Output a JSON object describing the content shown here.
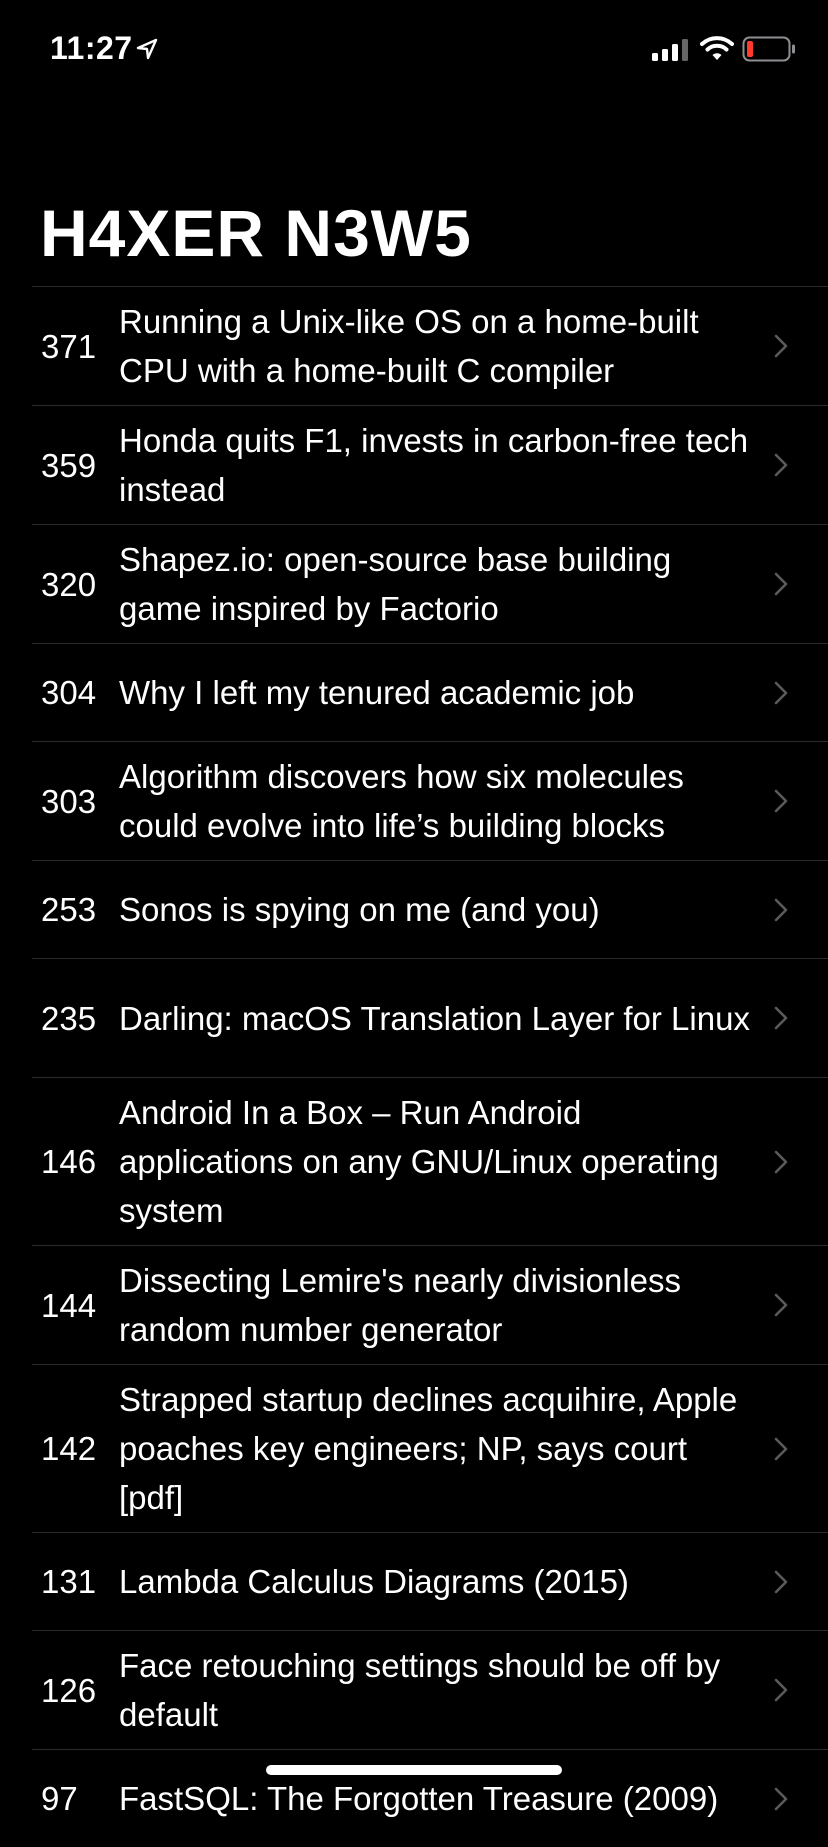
{
  "status": {
    "time": "11:27"
  },
  "title": "H4XER N3W5",
  "items": [
    {
      "points": "371",
      "title": "Running a Unix-like OS on a home-built CPU with a home-built C compiler"
    },
    {
      "points": "359",
      "title": "Honda quits F1, invests in carbon-free tech instead"
    },
    {
      "points": "320",
      "title": "Shapez.io: open-source base building game inspired by Factorio"
    },
    {
      "points": "304",
      "title": "Why I left my tenured academic job"
    },
    {
      "points": "303",
      "title": "Algorithm discovers how six molecules could evolve into life’s building blocks"
    },
    {
      "points": "253",
      "title": "Sonos is spying on me (and you)"
    },
    {
      "points": "235",
      "title": "Darling: macOS Translation Layer for Linux"
    },
    {
      "points": "146",
      "title": "Android In a Box – Run Android applications on any GNU/Linux operating system"
    },
    {
      "points": "144",
      "title": "Dissecting Lemire's nearly divisionless random number generator"
    },
    {
      "points": "142",
      "title": "Strapped startup declines acquihire, Apple poaches key engineers; NP, says court [pdf]"
    },
    {
      "points": "131",
      "title": "Lambda Calculus Diagrams (2015)"
    },
    {
      "points": "126",
      "title": "Face retouching settings should be off by default"
    },
    {
      "points": "97",
      "title": "FastSQL: The Forgotten Treasure (2009)"
    }
  ]
}
